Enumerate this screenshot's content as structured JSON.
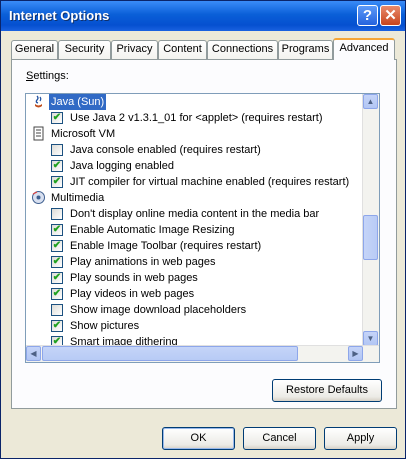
{
  "window": {
    "title": "Internet Options",
    "help_glyph": "?",
    "close_glyph": "✕"
  },
  "tabs": [
    {
      "label": "General",
      "active": false
    },
    {
      "label": "Security",
      "active": false
    },
    {
      "label": "Privacy",
      "active": false
    },
    {
      "label": "Content",
      "active": false
    },
    {
      "label": "Connections",
      "active": false
    },
    {
      "label": "Programs",
      "active": false
    },
    {
      "label": "Advanced",
      "active": true
    }
  ],
  "settings_label": "Settings:",
  "settings": [
    {
      "type": "category",
      "label": "Java (Sun)",
      "icon": "java-icon",
      "selected": true
    },
    {
      "type": "option",
      "label": "Use Java 2 v1.3.1_01 for <applet> (requires restart)",
      "checked": true
    },
    {
      "type": "category",
      "label": "Microsoft VM",
      "icon": "document-icon"
    },
    {
      "type": "option",
      "label": "Java console enabled (requires restart)",
      "checked": false
    },
    {
      "type": "option",
      "label": "Java logging enabled",
      "checked": true
    },
    {
      "type": "option",
      "label": "JIT compiler for virtual machine enabled (requires restart)",
      "checked": true
    },
    {
      "type": "category",
      "label": "Multimedia",
      "icon": "multimedia-icon"
    },
    {
      "type": "option",
      "label": "Don't display online media content in the media bar",
      "checked": false
    },
    {
      "type": "option",
      "label": "Enable Automatic Image Resizing",
      "checked": true
    },
    {
      "type": "option",
      "label": "Enable Image Toolbar (requires restart)",
      "checked": true
    },
    {
      "type": "option",
      "label": "Play animations in web pages",
      "checked": true
    },
    {
      "type": "option",
      "label": "Play sounds in web pages",
      "checked": true
    },
    {
      "type": "option",
      "label": "Play videos in web pages",
      "checked": true
    },
    {
      "type": "option",
      "label": "Show image download placeholders",
      "checked": false
    },
    {
      "type": "option",
      "label": "Show pictures",
      "checked": true
    },
    {
      "type": "option",
      "label": "Smart image dithering",
      "checked": true
    }
  ],
  "buttons": {
    "restore_defaults": "Restore Defaults",
    "ok": "OK",
    "cancel": "Cancel",
    "apply": "Apply"
  },
  "colors": {
    "titlebar": "#0a5fd8",
    "selection": "#316ac5",
    "active_tab_accent": "#f5a535",
    "check": "#21a121"
  }
}
